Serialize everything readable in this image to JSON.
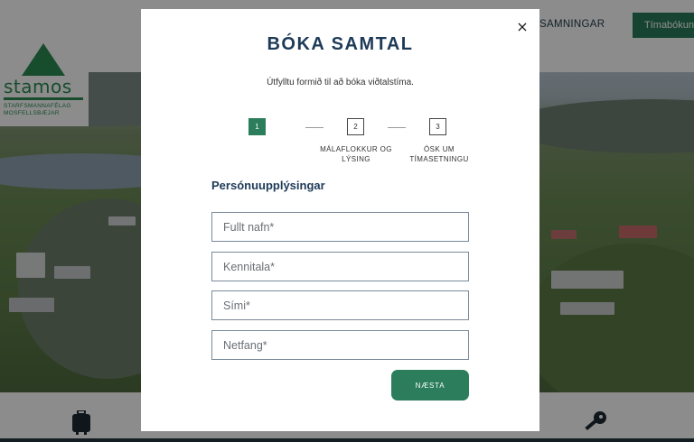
{
  "background": {
    "logo": {
      "word": "stamos",
      "subtitle": "STARFSMANNAFÉLAG MOSFELLSBÆJAR"
    },
    "nav": {
      "partial_item": "SAMNINGAR",
      "cta_label": "Tímabókun"
    },
    "footer_icons": [
      "suitcase-icon",
      "key-icon"
    ]
  },
  "modal": {
    "title": "BÓKA SAMTAL",
    "subtitle": "Útfylltu formið til að bóka viðtalstíma.",
    "close_label": "×",
    "steps": [
      {
        "number": "1",
        "label": "",
        "active": true
      },
      {
        "number": "2",
        "label": "MÁLAFLOKKUR OG LÝSING",
        "active": false
      },
      {
        "number": "3",
        "label": "ÓSK UM TÍMASETNINGU",
        "active": false
      }
    ],
    "section_heading": "Persónuupplýsingar",
    "fields": {
      "name": {
        "placeholder": "Fullt nafn*",
        "value": ""
      },
      "kennitala": {
        "placeholder": "Kennitala*",
        "value": ""
      },
      "phone": {
        "placeholder": "Sími*",
        "value": ""
      },
      "email": {
        "placeholder": "Netfang*",
        "value": ""
      }
    },
    "next_label": "NÆSTA"
  },
  "colors": {
    "accent": "#2b7d5b",
    "title": "#1d3a57",
    "overlay": "rgba(0,0,0,0.45)"
  }
}
